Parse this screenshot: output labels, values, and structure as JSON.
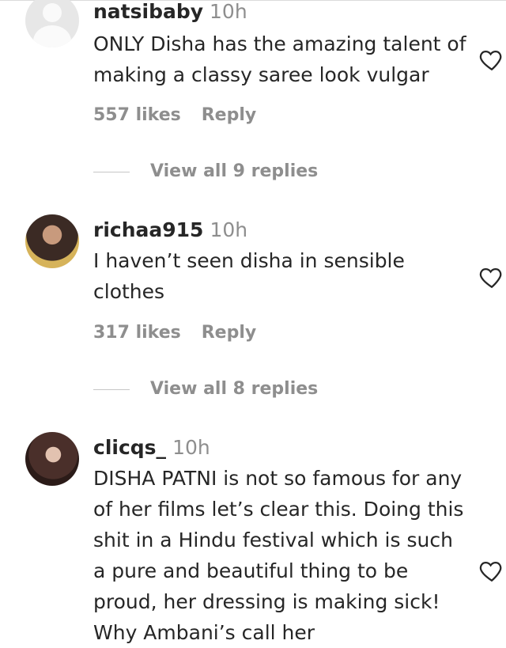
{
  "comments": [
    {
      "username": "natsibaby",
      "time": "10h",
      "text": "ONLY Disha has the amazing talent of making a classy saree look vulgar",
      "likes": "557 likes",
      "reply": "Reply",
      "view_replies": "View all 9 replies"
    },
    {
      "username": "richaa915",
      "time": "10h",
      "text": "I haven’t seen disha in sensible clothes",
      "likes": "317 likes",
      "reply": "Reply",
      "view_replies": "View all 8 replies"
    },
    {
      "username": "clicqs_",
      "time": "10h",
      "text": "DISHA PATNI is not so famous for any of her films let’s clear this. Doing this shit in a Hindu festival which is such a pure and beautiful thing to be proud, her dressing is making sick! Why Ambani’s call her"
    }
  ]
}
